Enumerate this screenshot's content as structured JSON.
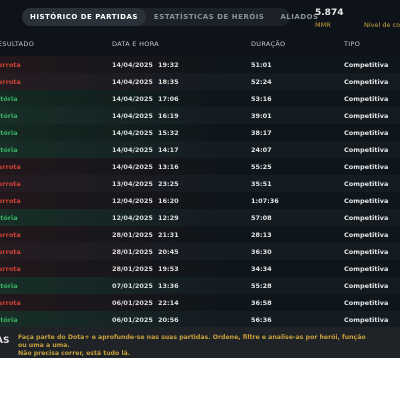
{
  "tabs": [
    {
      "label": "HISTÓRICO DE PARTIDAS",
      "active": true
    },
    {
      "label": "ESTATÍSTICAS DE HERÓIS",
      "active": false
    },
    {
      "label": "ALIADOS",
      "active": false
    }
  ],
  "stats": {
    "mmr_value": "5.874",
    "mmr_label": "MMR",
    "level_label": "Nível de co"
  },
  "table": {
    "headers": [
      "ESULTADO",
      "DATA E HORA",
      "",
      "DURAÇÃO",
      "TIPO"
    ],
    "rows": [
      {
        "result": "errota",
        "outcome": "loss",
        "date": "14/04/2025",
        "time": "19:32",
        "duration": "51:01",
        "type": "Competitiva"
      },
      {
        "result": "errota",
        "outcome": "loss",
        "date": "14/04/2025",
        "time": "18:35",
        "duration": "52:24",
        "type": "Competitiva"
      },
      {
        "result": "itória",
        "outcome": "win",
        "date": "14/04/2025",
        "time": "17:06",
        "duration": "53:16",
        "type": "Competitiva"
      },
      {
        "result": "itória",
        "outcome": "win",
        "date": "14/04/2025",
        "time": "16:19",
        "duration": "39:01",
        "type": "Competitiva"
      },
      {
        "result": "itória",
        "outcome": "win",
        "date": "14/04/2025",
        "time": "15:32",
        "duration": "38:17",
        "type": "Competitiva"
      },
      {
        "result": "itória",
        "outcome": "win",
        "date": "14/04/2025",
        "time": "14:17",
        "duration": "24:07",
        "type": "Competitiva"
      },
      {
        "result": "errota",
        "outcome": "loss",
        "date": "14/04/2025",
        "time": "13:16",
        "duration": "55:25",
        "type": "Competitiva"
      },
      {
        "result": "errota",
        "outcome": "loss",
        "date": "13/04/2025",
        "time": "23:25",
        "duration": "35:51",
        "type": "Competitiva"
      },
      {
        "result": "errota",
        "outcome": "loss",
        "date": "12/04/2025",
        "time": "16:20",
        "duration": "1:07:36",
        "type": "Competitiva"
      },
      {
        "result": "itória",
        "outcome": "win",
        "date": "12/04/2025",
        "time": "12:29",
        "duration": "57:08",
        "type": "Competitiva"
      },
      {
        "result": "errota",
        "outcome": "loss",
        "date": "28/01/2025",
        "time": "21:31",
        "duration": "28:13",
        "type": "Competitiva"
      },
      {
        "result": "errota",
        "outcome": "loss",
        "date": "28/01/2025",
        "time": "20:45",
        "duration": "36:30",
        "type": "Competitiva"
      },
      {
        "result": "errota",
        "outcome": "loss",
        "date": "28/01/2025",
        "time": "19:53",
        "duration": "34:34",
        "type": "Competitiva"
      },
      {
        "result": "itória",
        "outcome": "win",
        "date": "07/01/2025",
        "time": "13:36",
        "duration": "55:28",
        "type": "Competitiva"
      },
      {
        "result": "errota",
        "outcome": "loss",
        "date": "06/01/2025",
        "time": "22:14",
        "duration": "36:58",
        "type": "Competitiva"
      },
      {
        "result": "itória",
        "outcome": "win",
        "date": "06/01/2025",
        "time": "20:56",
        "duration": "56:36",
        "type": "Competitiva"
      }
    ]
  },
  "banner": {
    "icon_text": "AS",
    "line1": "Faça parte do Dota+ e aprofunde-se nas suas partidas. Ordene, filtre e analise-as por herói, função ou uma a uma.",
    "line2": "Não precisa correr, está tudo lá."
  },
  "colors": {
    "loss": "#e14a3a",
    "win": "#39c26a",
    "accent_gold": "#c9a23b",
    "background": "#0d1318"
  }
}
